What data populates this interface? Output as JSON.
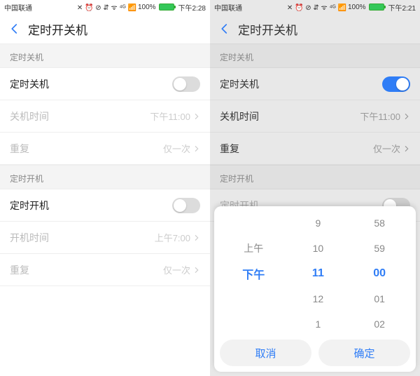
{
  "left": {
    "status": {
      "carrier": "中国联通",
      "battery_pct": "100%",
      "clock": "下午2:28",
      "signal_glyphs": "✕ ⏰ ⊘ ⇵ ᯤ ⁴ᴳ 📶"
    },
    "header": {
      "title": "定时开关机"
    },
    "shutdown": {
      "section_label": "定时关机",
      "toggle_label": "定时关机",
      "toggle_on": false,
      "time_label": "关机时间",
      "time_value": "下午11:00",
      "repeat_label": "重复",
      "repeat_value": "仅一次"
    },
    "startup": {
      "section_label": "定时开机",
      "toggle_label": "定时开机",
      "toggle_on": false,
      "time_label": "开机时间",
      "time_value": "上午7:00",
      "repeat_label": "重复",
      "repeat_value": "仅一次"
    }
  },
  "right": {
    "status": {
      "carrier": "中国联通",
      "battery_pct": "100%",
      "clock": "下午2:21",
      "signal_glyphs": "✕ ⏰ ⊘ ⇵ ᯤ ⁴ᴳ 📶"
    },
    "header": {
      "title": "定时开关机"
    },
    "shutdown": {
      "section_label": "定时关机",
      "toggle_label": "定时关机",
      "toggle_on": true,
      "time_label": "关机时间",
      "time_value": "下午11:00",
      "repeat_label": "重复",
      "repeat_value": "仅一次"
    },
    "startup": {
      "section_label": "定时开机",
      "toggle_label": "定时开机",
      "toggle_on": false
    },
    "picker": {
      "ampm": {
        "options": [
          "上午",
          "下午"
        ],
        "selected": "下午"
      },
      "hour": {
        "options": [
          "9",
          "10",
          "11",
          "12",
          "1"
        ],
        "selected": "11"
      },
      "minute": {
        "options": [
          "58",
          "59",
          "00",
          "01",
          "02"
        ],
        "selected": "00"
      },
      "cancel": "取消",
      "confirm": "确定"
    }
  }
}
